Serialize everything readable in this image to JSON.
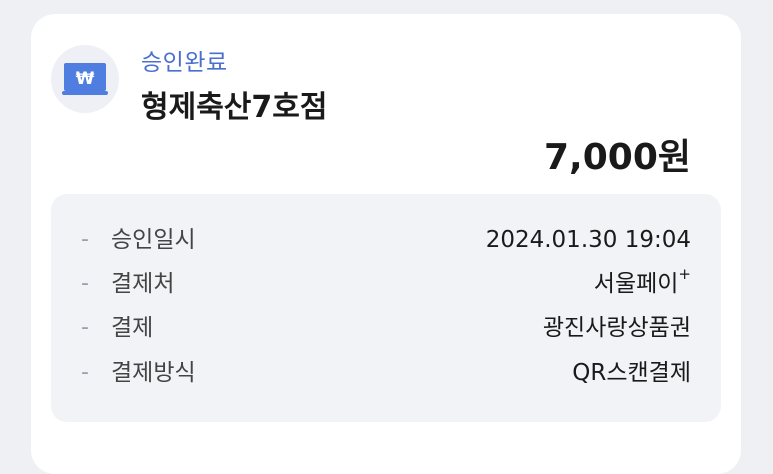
{
  "status_label": "승인완료",
  "merchant_name": "형제축산7호점",
  "amount": "7,000원",
  "icon": {
    "name": "won-card-icon",
    "symbol": "₩",
    "color": "#4f7de0"
  },
  "details": [
    {
      "label": "승인일시",
      "value": "2024.01.30 19:04",
      "suffix": ""
    },
    {
      "label": "결제처",
      "value": "서울페이",
      "suffix": "+"
    },
    {
      "label": "결제",
      "value": "광진사랑상품권",
      "suffix": ""
    },
    {
      "label": "결제방식",
      "value": "QR스캔결제",
      "suffix": ""
    }
  ],
  "colors": {
    "accent": "#4a6fd0",
    "background": "#eef0f4",
    "card": "#ffffff",
    "details_bg": "#f1f3f7"
  }
}
